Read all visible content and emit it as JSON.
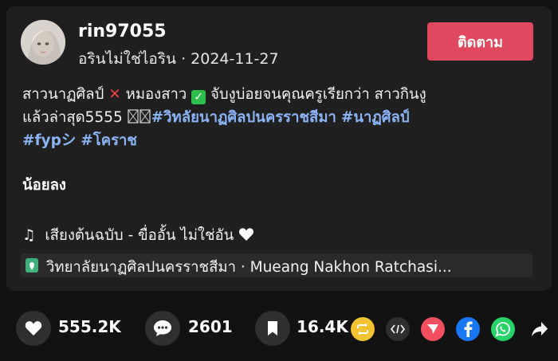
{
  "post": {
    "username": "rin97055",
    "display_name": "อรินไม่ใช่ไอริน",
    "separator": "·",
    "date": "2024-11-27",
    "follow_label": "ติดตาม",
    "caption": {
      "text1": "สาวนาฏศิลป์",
      "text2": "หมองสาว",
      "text3": "จับงูบ่อยจนคุณครูเรียกว่า สาวกินงู",
      "text4": "แล้วล่าสุด5555",
      "hashtags": [
        "#วิทลัยนาฏศิลปนครราชสีมา",
        "#นาฏศิลป์",
        "#fypシ",
        "#โคราช"
      ]
    },
    "less_label": "น้อยลง",
    "music": {
      "note": "♫",
      "text": "เสียงต้นฉบับ - ขื่ออั้น ไม่ใช่อัน"
    },
    "location": "วิทยาลัยนาฏศิลปนครราชสีมา · Mueang Nakhon Ratchasi..."
  },
  "actions": {
    "likes": "555.2K",
    "comments": "2601",
    "saves": "16.4K"
  },
  "colors": {
    "accent": "#e0485e",
    "hashtag": "#8ab4f8",
    "background": "#121212",
    "card": "#1f1f1f"
  },
  "icons": [
    "heart-icon",
    "comment-icon",
    "bookmark-icon",
    "repost-icon",
    "embed-icon",
    "send-icon",
    "facebook-icon",
    "whatsapp-icon",
    "share-arrow-icon",
    "location-pin-icon"
  ]
}
